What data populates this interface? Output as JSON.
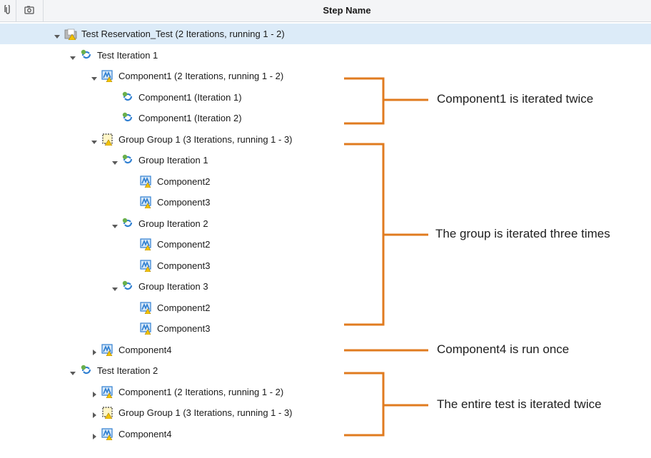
{
  "header": {
    "title": "Step Name",
    "icons": [
      "paperclip-icon",
      "camera-icon"
    ]
  },
  "rows": [
    {
      "label": "Test Reservation_Test (2 Iterations, running 1 - 2)",
      "icon": "test-folder-icon",
      "arrow": "down",
      "selected": true
    },
    {
      "label": "Test Iteration 1",
      "icon": "iteration-icon",
      "arrow": "down"
    },
    {
      "label": "Component1 (2 Iterations, running 1 - 2)",
      "icon": "component-icon",
      "arrow": "down"
    },
    {
      "label": "Component1 (Iteration 1)",
      "icon": "iteration-icon",
      "arrow": "none"
    },
    {
      "label": "Component1 (Iteration 2)",
      "icon": "iteration-icon",
      "arrow": "none"
    },
    {
      "label": "Group Group 1 (3 Iterations, running 1 - 3)",
      "icon": "group-icon",
      "arrow": "down"
    },
    {
      "label": "Group Iteration 1",
      "icon": "iteration-icon",
      "arrow": "down"
    },
    {
      "label": "Component2",
      "icon": "component-icon",
      "arrow": "none"
    },
    {
      "label": "Component3",
      "icon": "component-icon",
      "arrow": "none"
    },
    {
      "label": "Group Iteration 2",
      "icon": "iteration-icon",
      "arrow": "down"
    },
    {
      "label": "Component2",
      "icon": "component-icon",
      "arrow": "none"
    },
    {
      "label": "Component3",
      "icon": "component-icon",
      "arrow": "none"
    },
    {
      "label": "Group Iteration 3",
      "icon": "iteration-icon",
      "arrow": "down"
    },
    {
      "label": "Component2",
      "icon": "component-icon",
      "arrow": "none"
    },
    {
      "label": "Component3",
      "icon": "component-icon",
      "arrow": "none"
    },
    {
      "label": "Component4",
      "icon": "component-icon",
      "arrow": "right"
    },
    {
      "label": "Test Iteration 2",
      "icon": "iteration-icon",
      "arrow": "down"
    },
    {
      "label": "Component1 (2 Iterations, running 1 - 2)",
      "icon": "component-icon",
      "arrow": "right"
    },
    {
      "label": "Group Group 1 (3 Iterations, running 1 - 3)",
      "icon": "group-icon",
      "arrow": "right"
    },
    {
      "label": "Component4",
      "icon": "component-icon",
      "arrow": "right"
    }
  ],
  "annotations": [
    {
      "text": "Component1 is iterated twice"
    },
    {
      "text": "The group is iterated three times"
    },
    {
      "text": "Component4 is run once"
    },
    {
      "text": "The entire test is iterated twice"
    }
  ],
  "colors": {
    "annotation_bracket": "#e07b1f",
    "selected_row": "#dcebf8",
    "component_blue": "#2f7fd1",
    "iteration_green": "#6ab04c",
    "warning_yellow": "#f2c200"
  }
}
